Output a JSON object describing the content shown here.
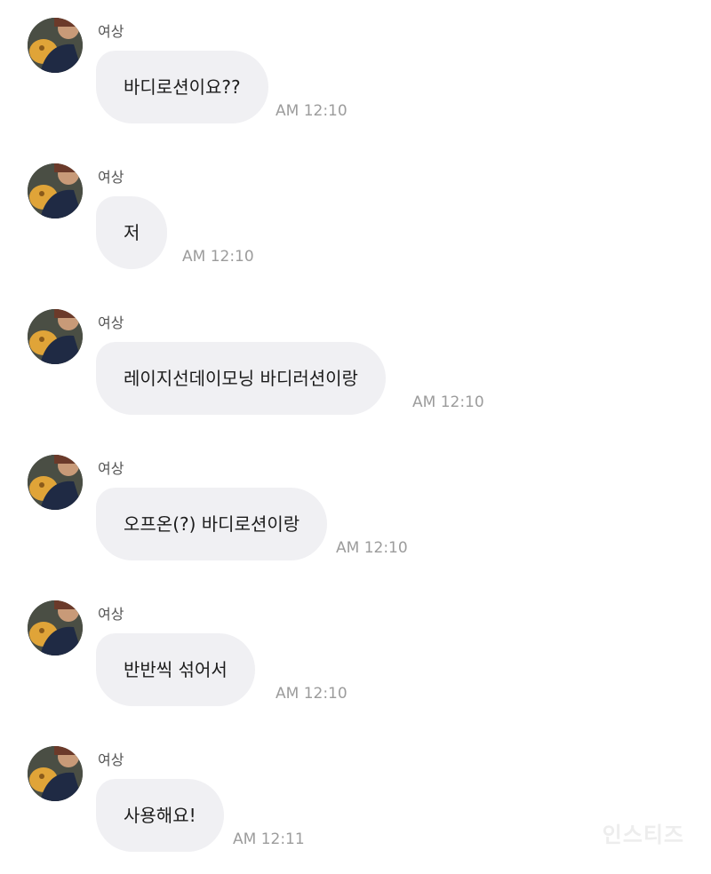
{
  "messages": [
    {
      "sender": "여상",
      "text": "바디로션이요??",
      "time": "AM 12:10"
    },
    {
      "sender": "여상",
      "text": "저",
      "time": "AM 12:10"
    },
    {
      "sender": "여상",
      "text": "레이지선데이모닝 바디러션이랑",
      "time": "AM 12:10"
    },
    {
      "sender": "여상",
      "text": "오프온(?) 바디로션이랑",
      "time": "AM 12:10"
    },
    {
      "sender": "여상",
      "text": "반반씩 섞어서",
      "time": "AM 12:10"
    },
    {
      "sender": "여상",
      "text": "사용해요!",
      "time": "AM 12:11"
    }
  ],
  "watermark": "인스티즈"
}
